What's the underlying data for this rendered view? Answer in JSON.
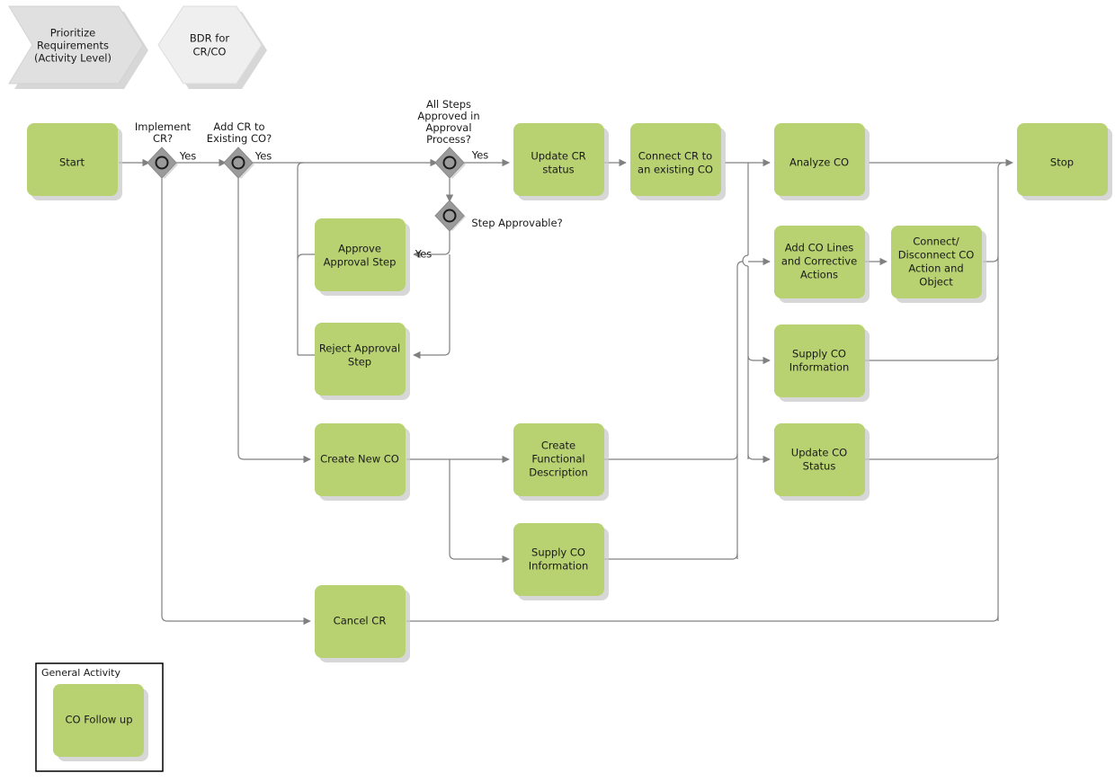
{
  "diagram": {
    "title": "CO Follow up",
    "colors": {
      "task_fill": "#b8d171",
      "edge_stroke": "#808080",
      "gateway_fill": "#9a9a9a",
      "pre_shape_fill": "#e0e0e0",
      "pre_shape_2_fill": "#efefef",
      "text": "#1a1a1a",
      "shadow": "#c9c9c9"
    },
    "predecessors": [
      {
        "id": "prioritize",
        "label": [
          "Prioritize",
          "Requirements",
          "(Activity Level)"
        ],
        "shape": "chevron"
      },
      {
        "id": "bdr",
        "label": [
          "BDR for",
          "CR/CO"
        ],
        "shape": "hexagon"
      }
    ],
    "tasks": [
      {
        "id": "start",
        "label": [
          "Start"
        ]
      },
      {
        "id": "update-cr-status",
        "label": [
          "Update CR",
          "status"
        ]
      },
      {
        "id": "connect-cr-existing-co",
        "label": [
          "Connect CR to",
          "an existing CO"
        ]
      },
      {
        "id": "analyze-co",
        "label": [
          "Analyze CO"
        ]
      },
      {
        "id": "stop",
        "label": [
          "Stop"
        ]
      },
      {
        "id": "approve-approval-step",
        "label": [
          "Approve",
          "Approval Step"
        ]
      },
      {
        "id": "reject-approval-step",
        "label": [
          "Reject Approval",
          "Step"
        ]
      },
      {
        "id": "add-co-lines",
        "label": [
          "Add CO Lines",
          "and Corrective",
          "Actions"
        ]
      },
      {
        "id": "connect-disconnect-co",
        "label": [
          "Connect/",
          "Disconnect CO",
          "Action and",
          "Object"
        ]
      },
      {
        "id": "supply-co-information-right",
        "label": [
          "Supply CO",
          "Information"
        ]
      },
      {
        "id": "update-co-status",
        "label": [
          "Update CO",
          "Status"
        ]
      },
      {
        "id": "create-new-co",
        "label": [
          "Create New CO"
        ]
      },
      {
        "id": "create-functional-description",
        "label": [
          "Create",
          "Functional",
          "Description"
        ]
      },
      {
        "id": "supply-co-information-mid",
        "label": [
          "Supply CO",
          "Information"
        ]
      },
      {
        "id": "cancel-cr",
        "label": [
          "Cancel CR"
        ]
      }
    ],
    "gateways": [
      {
        "id": "implement-cr",
        "label": [
          "Implement",
          "CR?"
        ]
      },
      {
        "id": "add-cr-existing-co",
        "label": [
          "Add CR to",
          "Existing CO?"
        ]
      },
      {
        "id": "all-steps-approved",
        "label": [
          "All Steps",
          "Approved in",
          "Approval",
          "Process?"
        ]
      },
      {
        "id": "step-approvable",
        "label": [
          "Step Approvable?"
        ]
      }
    ],
    "edge_labels": {
      "implement_cr_yes": "Yes",
      "add_cr_yes": "Yes",
      "all_steps_yes": "Yes",
      "step_approvable_yes": "Yes"
    },
    "legend": {
      "caption": "General Activity",
      "item_label": "CO Follow up"
    }
  }
}
